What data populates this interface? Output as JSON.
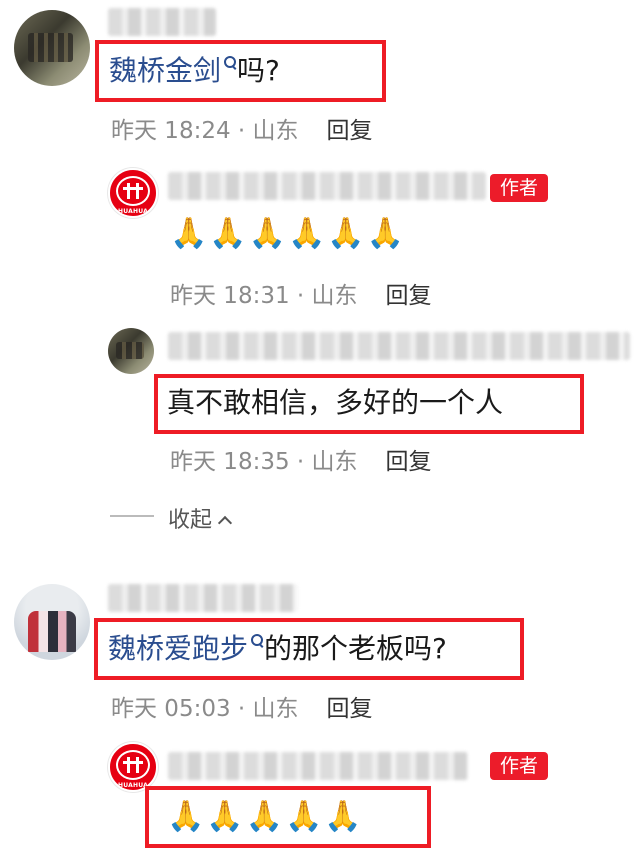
{
  "comments": [
    {
      "text_link": "魏桥金剑",
      "text_rest": "吗?",
      "time": "昨天 18:24 · 山东",
      "reply": "回复",
      "replies": [
        {
          "badge": "作者",
          "emojis": "🙏🙏🙏🙏🙏🙏",
          "time": "昨天 18:31 · 山东",
          "reply": "回复"
        },
        {
          "text": "真不敢相信，多好的一个人",
          "time": "昨天 18:35 · 山东",
          "reply": "回复"
        }
      ],
      "collapse_label": "收起"
    },
    {
      "text_link": "魏桥爱跑步",
      "text_rest": "的那个老板吗?",
      "time": "昨天 05:03 · 山东",
      "reply": "回复",
      "replies": [
        {
          "badge": "作者",
          "emojis": "🙏🙏🙏🙏🙏"
        }
      ]
    }
  ],
  "brand_avatar_text": "HUAHUA",
  "colors": {
    "highlight": "#ee1c25",
    "link": "#2a4d8f",
    "author_badge": "#ec1c2a",
    "meta": "#8a8a8a"
  }
}
